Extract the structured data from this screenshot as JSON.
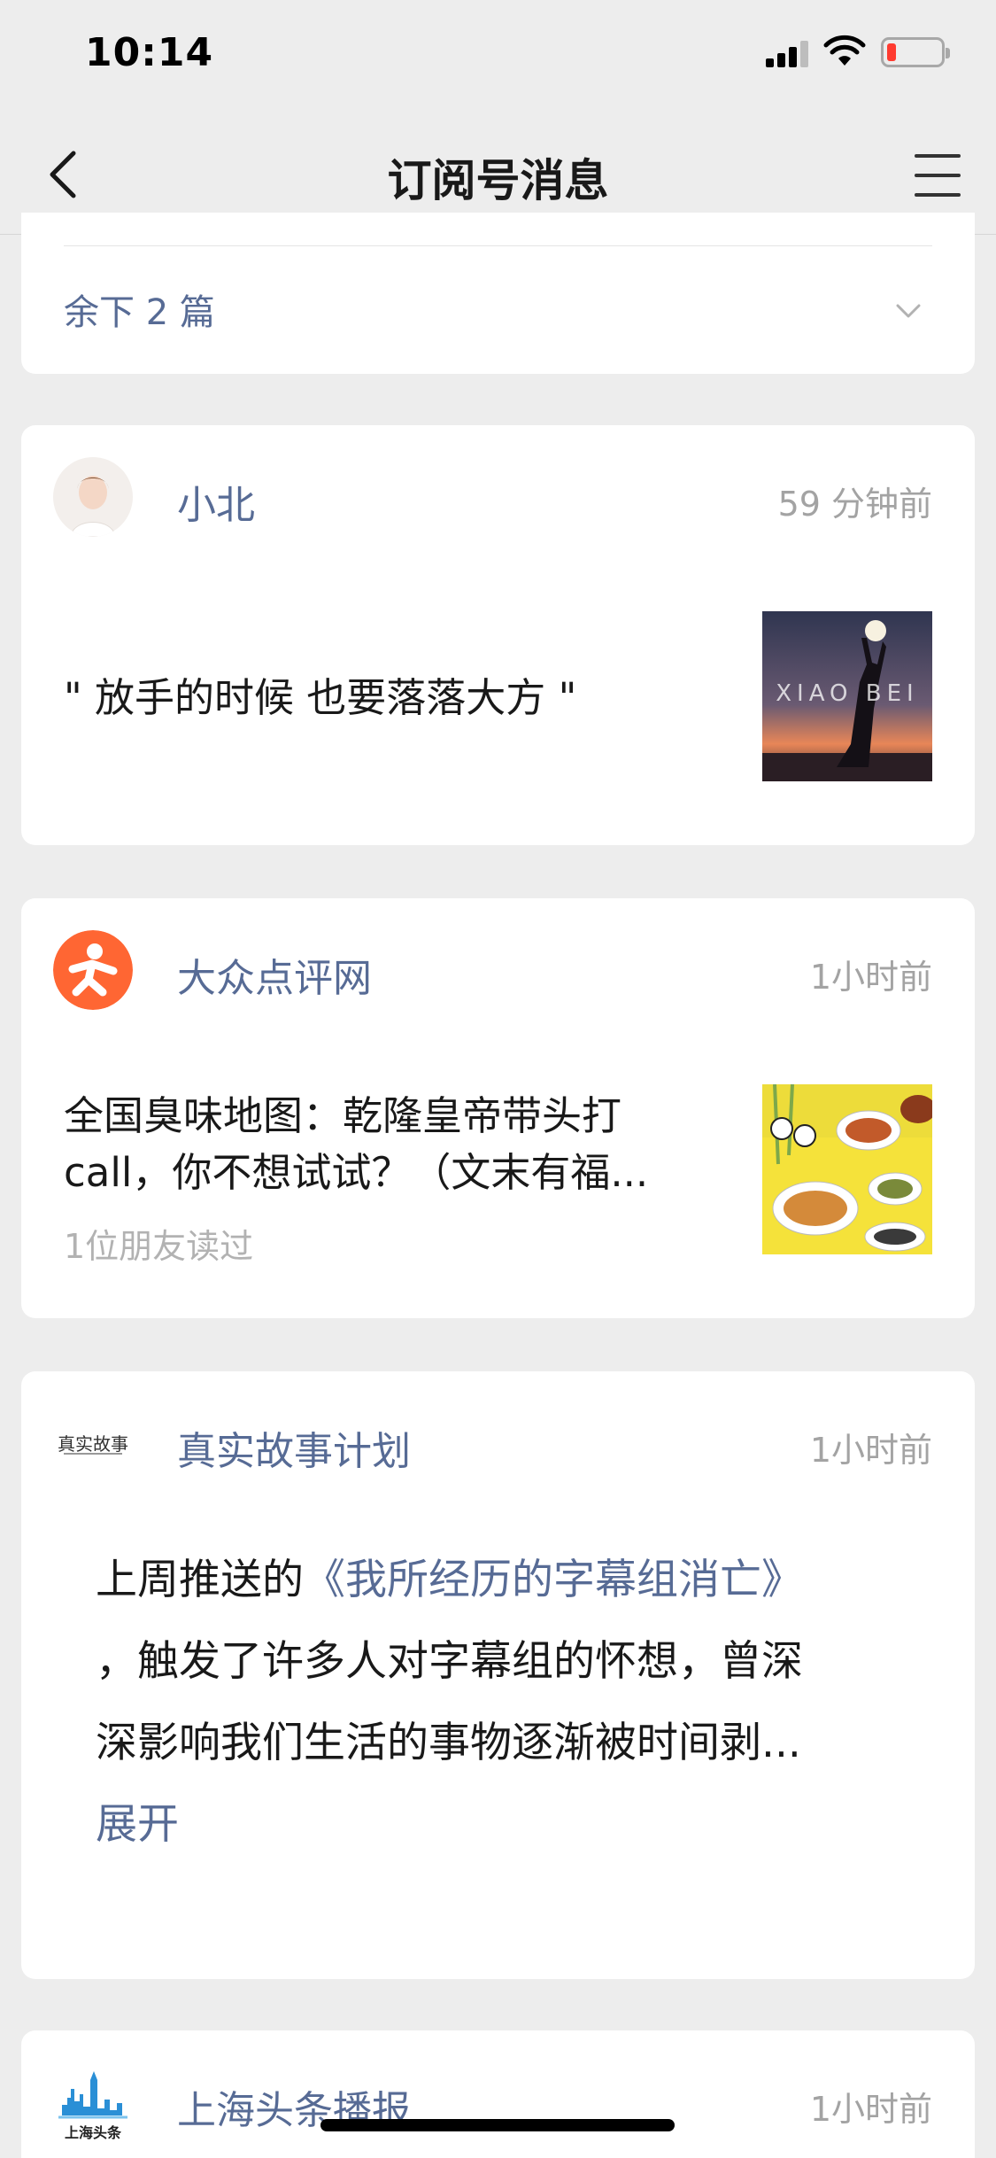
{
  "status_bar": {
    "time": "10:14"
  },
  "nav": {
    "title": "订阅号消息"
  },
  "top_card": {
    "more_label": "余下 2 篇"
  },
  "feed": [
    {
      "account": "小北",
      "time": "59 分钟前",
      "title": "\" 放手的时候 也要落落大方 \"",
      "thumb_text": "XIAO BEI"
    },
    {
      "account": "大众点评网",
      "time": "1小时前",
      "title_line1": "全国臭味地图：乾隆皇帝带头打",
      "title_line2": "call，你不想试试？（文末有福...",
      "read_by": "1位朋友读过"
    },
    {
      "account": "真实故事计划",
      "time": "1小时前",
      "logo_text": "真实故事",
      "text_prefix": "上周推送的",
      "text_link": "《我所经历的字幕组消亡》",
      "text_line2": "，触发了许多人对字幕组的怀想，曾深",
      "text_line3": "深影响我们生活的事物逐渐被时间剥...",
      "expand": "展开"
    },
    {
      "account": "上海头条播报",
      "time": "1小时前",
      "logo_text": "上海头条"
    }
  ]
}
